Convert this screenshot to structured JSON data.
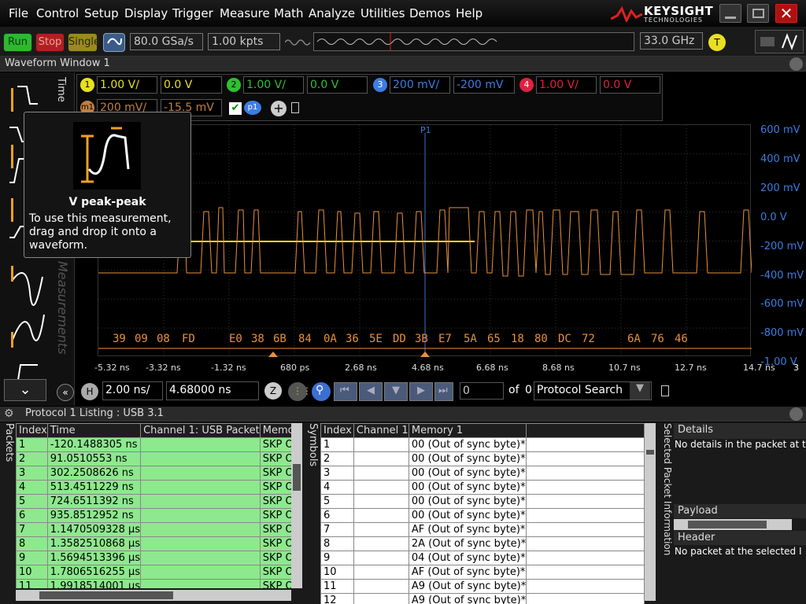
{
  "menu": [
    "File",
    "Control",
    "Setup",
    "Display",
    "Trigger",
    "Measure",
    "Math",
    "Analyze",
    "Utilities",
    "Demos",
    "Help"
  ],
  "brand": {
    "name": "KEYSIGHT",
    "sub": "TECHNOLOGIES"
  },
  "toolbar": {
    "run": "Run",
    "stop": "Stop",
    "single": "Single",
    "sample_rate": "80.0 GSa/s",
    "points": "1.00 kpts",
    "bandwidth": "33.0 GHz",
    "trigger_badge": "T"
  },
  "waveform_window": {
    "title": "Waveform Window 1"
  },
  "channels": [
    {
      "num": "1",
      "scale": "1.00 V/",
      "offset": "0.0 V",
      "color": "#e8e020"
    },
    {
      "num": "2",
      "scale": "1.00 V/",
      "offset": "0.0 V",
      "color": "#30c030"
    },
    {
      "num": "3",
      "scale": "200 mV/",
      "offset": "-200 mV",
      "color": "#3c7de0"
    },
    {
      "num": "4",
      "scale": "1.00 V/",
      "offset": "0.0 V",
      "color": "#e02040"
    }
  ],
  "math": {
    "label": "m1",
    "scale": "200 mV/",
    "offset": "-15.5 mV",
    "p1": "p1"
  },
  "side_tabs": {
    "time": "Time",
    "measurements": "Measurements"
  },
  "tooltip": {
    "title": "V peak-peak",
    "body": "To use this measurement, drag and drop it onto a waveform."
  },
  "marker": "P1",
  "y_labels": [
    "600 mV",
    "400 mV",
    "200 mV",
    "0.0 V",
    "-200 mV",
    "-400 mV",
    "-600 mV",
    "-800 mV",
    "-1.00 V"
  ],
  "x_labels": [
    "-5.32 ns",
    "-3.32 ns",
    "-1.32 ns",
    "680 ps",
    "2.68 ns",
    "4.68 ns",
    "6.68 ns",
    "8.68 ns",
    "10.7 ns",
    "12.7 ns",
    "14.7 ns"
  ],
  "decode_bytes": [
    "39",
    "09",
    "08",
    "FD",
    "E0",
    "38",
    "6B",
    "84",
    "0A",
    "36",
    "5E",
    "DD",
    "3B",
    "E7",
    "5A",
    "65",
    "18",
    "80",
    "DC",
    "72",
    "6A",
    "76",
    "46"
  ],
  "timebase": {
    "h": "H",
    "scale": "2.00 ns/",
    "position": "4.68000 ns",
    "z": "Z",
    "page": "0",
    "of": "of",
    "total": "0",
    "search": "Protocol Search"
  },
  "listing": {
    "title": "Protocol 1 Listing : USB 3.1",
    "packets_tab": "Packets",
    "symbols_tab": "Symbols",
    "selected_tab": "Selected Packet Information",
    "packet_headers": [
      "Index",
      "Time",
      "Channel 1: USB Packet",
      "Memor"
    ],
    "packets": [
      [
        "1",
        "-120.1488305 ns",
        "",
        "SKP Or"
      ],
      [
        "2",
        "91.0510553 ns",
        "",
        "SKP Or"
      ],
      [
        "3",
        "302.2508626 ns",
        "",
        "SKP Or"
      ],
      [
        "4",
        "513.4511229 ns",
        "",
        "SKP Or"
      ],
      [
        "5",
        "724.6511392 ns",
        "",
        "SKP Or"
      ],
      [
        "6",
        "935.8512952 ns",
        "",
        "SKP Or"
      ],
      [
        "7",
        "1.1470509328 µs",
        "",
        "SKP Or"
      ],
      [
        "8",
        "1.3582510868 µs",
        "",
        "SKP Or"
      ],
      [
        "9",
        "1.5694513396 µs",
        "",
        "SKP Or"
      ],
      [
        "10",
        "1.7806516255 µs",
        "",
        "SKP Or"
      ],
      [
        "11",
        "1.9918514001 µs",
        "",
        "SKP Or"
      ]
    ],
    "symbol_headers": [
      "Index",
      "Channel 1",
      "Memory 1",
      ""
    ],
    "symbols": [
      [
        "1",
        "",
        "00 (Out of sync byte)*",
        ""
      ],
      [
        "2",
        "",
        "00 (Out of sync byte)*",
        ""
      ],
      [
        "3",
        "",
        "00 (Out of sync byte)*",
        ""
      ],
      [
        "4",
        "",
        "00 (Out of sync byte)*",
        ""
      ],
      [
        "5",
        "",
        "00 (Out of sync byte)*",
        ""
      ],
      [
        "6",
        "",
        "00 (Out of sync byte)*",
        ""
      ],
      [
        "7",
        "",
        "AF (Out of sync byte)*",
        ""
      ],
      [
        "8",
        "",
        "2A (Out of sync byte)*",
        ""
      ],
      [
        "9",
        "",
        "04 (Out of sync byte)*",
        ""
      ],
      [
        "10",
        "",
        "AF (Out of sync byte)*",
        ""
      ],
      [
        "11",
        "",
        "A9 (Out of sync byte)*",
        ""
      ],
      [
        "12",
        "",
        "A9 (Out of sync byte)*",
        ""
      ]
    ],
    "details": {
      "title": "Details",
      "text": "No details in the packet at the",
      "payload": "Payload",
      "header": "Header",
      "header_text": "No packet at the selected I"
    }
  }
}
